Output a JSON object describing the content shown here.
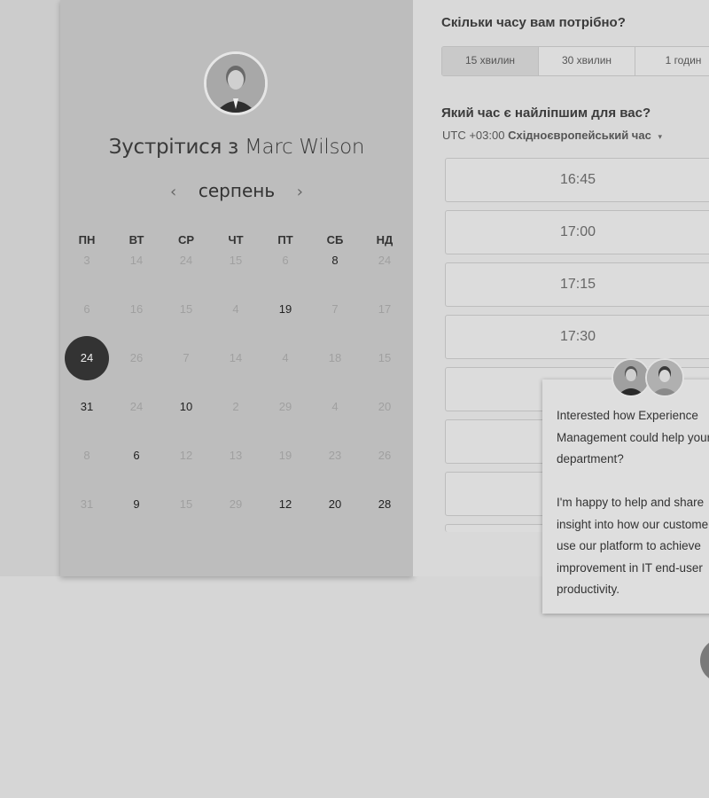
{
  "left": {
    "title_prefix": "Зустрітися з",
    "host_name": "Marc Wilson",
    "month": "серпень",
    "prev_icon": "‹",
    "next_icon": "›",
    "weekdays": [
      "ПН",
      "ВТ",
      "СР",
      "ЧТ",
      "ПТ",
      "СБ",
      "НД"
    ],
    "weeks": [
      [
        {
          "d": "3",
          "s": "muted"
        },
        {
          "d": "14",
          "s": "muted"
        },
        {
          "d": "24",
          "s": "muted"
        },
        {
          "d": "15",
          "s": "muted"
        },
        {
          "d": "6",
          "s": "muted"
        },
        {
          "d": "8",
          "s": "active"
        },
        {
          "d": "24",
          "s": "muted"
        }
      ],
      [
        {
          "d": "6",
          "s": "muted"
        },
        {
          "d": "16",
          "s": "muted"
        },
        {
          "d": "15",
          "s": "muted"
        },
        {
          "d": "4",
          "s": "muted"
        },
        {
          "d": "19",
          "s": "active"
        },
        {
          "d": "7",
          "s": "muted"
        },
        {
          "d": "17",
          "s": "muted"
        }
      ],
      [
        {
          "d": "24",
          "s": "selected"
        },
        {
          "d": "26",
          "s": "muted"
        },
        {
          "d": "7",
          "s": "muted"
        },
        {
          "d": "14",
          "s": "muted"
        },
        {
          "d": "4",
          "s": "muted"
        },
        {
          "d": "18",
          "s": "muted"
        },
        {
          "d": "15",
          "s": "muted"
        }
      ],
      [
        {
          "d": "31",
          "s": "active"
        },
        {
          "d": "24",
          "s": "muted"
        },
        {
          "d": "10",
          "s": "active"
        },
        {
          "d": "2",
          "s": "muted"
        },
        {
          "d": "29",
          "s": "muted"
        },
        {
          "d": "4",
          "s": "muted"
        },
        {
          "d": "20",
          "s": "muted"
        }
      ],
      [
        {
          "d": "8",
          "s": "muted"
        },
        {
          "d": "6",
          "s": "active"
        },
        {
          "d": "12",
          "s": "muted"
        },
        {
          "d": "13",
          "s": "muted"
        },
        {
          "d": "19",
          "s": "muted"
        },
        {
          "d": "23",
          "s": "muted"
        },
        {
          "d": "26",
          "s": "muted"
        }
      ],
      [
        {
          "d": "31",
          "s": "muted"
        },
        {
          "d": "9",
          "s": "active"
        },
        {
          "d": "15",
          "s": "muted"
        },
        {
          "d": "29",
          "s": "muted"
        },
        {
          "d": "12",
          "s": "active"
        },
        {
          "d": "20",
          "s": "active"
        },
        {
          "d": "28",
          "s": "active"
        }
      ]
    ]
  },
  "right": {
    "duration_question": "Скільки часу вам потрібно?",
    "durations": [
      "15 хвилин",
      "30 хвилин",
      "1 годин"
    ],
    "selected_duration": 0,
    "time_question": "Який час є найліпшим для вас?",
    "tz_offset": "UTC +03:00",
    "tz_name": "Східноєвропейський час",
    "tz_caret": "▾",
    "slots": [
      "16:45",
      "17:00",
      "17:15",
      "17:30",
      "",
      "",
      "",
      ""
    ]
  },
  "chat": {
    "message": "Interested how Experience Management could help your department?\n\nI'm happy to help and share insight into how our customers use our platform to achieve improvement in IT end-user productivity."
  }
}
